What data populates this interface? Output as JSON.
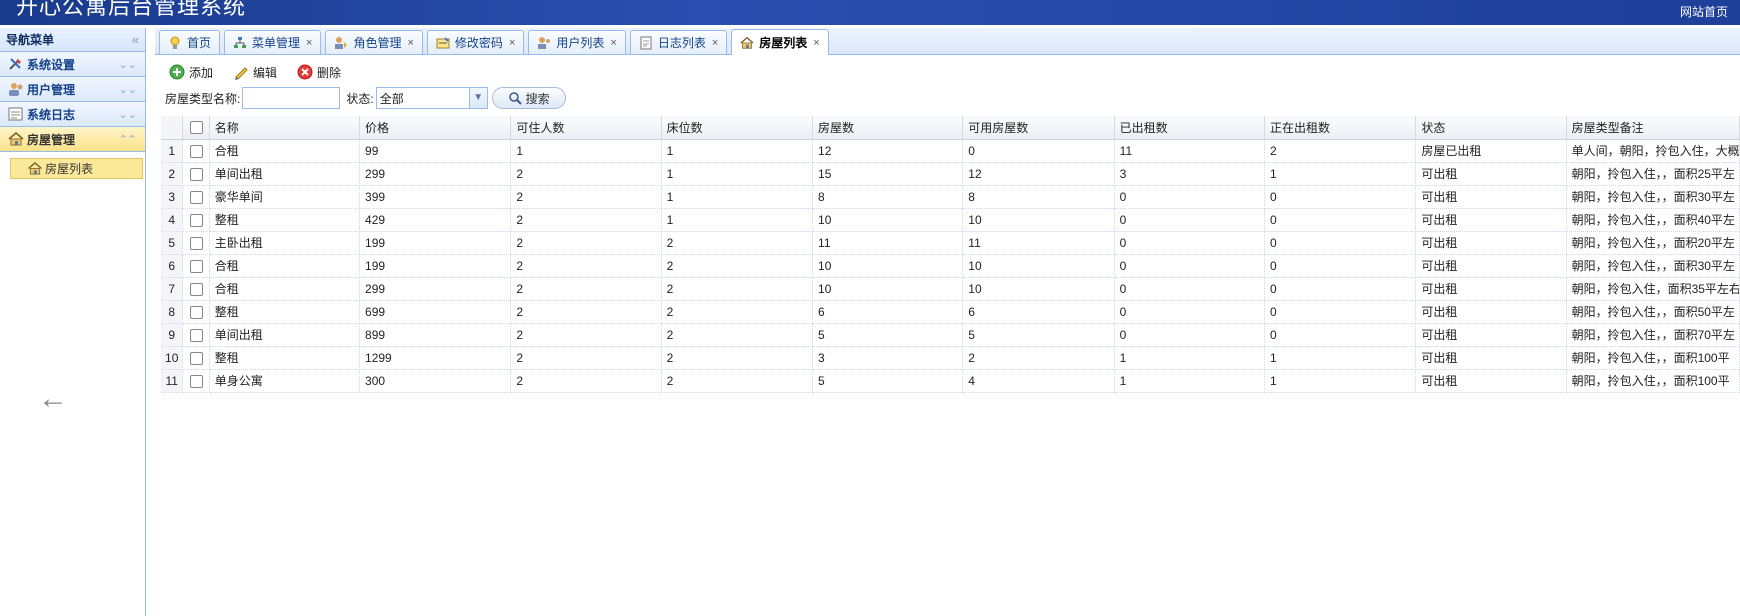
{
  "header": {
    "title": "开心公寓后台管理系统",
    "home_link": "网站首页"
  },
  "sidebar": {
    "title": "导航菜单",
    "collapse_icon": "double-chevron-left",
    "panels": [
      {
        "label": "系统设置",
        "icon": "tools-icon"
      },
      {
        "label": "用户管理",
        "icon": "users-icon"
      },
      {
        "label": "系统日志",
        "icon": "log-icon"
      },
      {
        "label": "房屋管理",
        "icon": "house-icon",
        "active": true
      }
    ],
    "sub_item": {
      "label": "房屋列表",
      "icon": "house-icon"
    }
  },
  "tabs": [
    {
      "label": "首页",
      "closable": false
    },
    {
      "label": "菜单管理",
      "closable": true
    },
    {
      "label": "角色管理",
      "closable": true
    },
    {
      "label": "修改密码",
      "closable": true
    },
    {
      "label": "用户列表",
      "closable": true
    },
    {
      "label": "日志列表",
      "closable": true
    },
    {
      "label": "房屋列表",
      "closable": true,
      "active": true
    }
  ],
  "tab_close": "×",
  "toolbar": {
    "add": "添加",
    "edit": "编辑",
    "delete": "删除"
  },
  "search": {
    "name_label": "房屋类型名称:",
    "name_value": "",
    "status_label": "状态:",
    "status_value": "全部",
    "search_button": "搜索"
  },
  "table": {
    "columns": [
      "名称",
      "价格",
      "可住人数",
      "床位数",
      "房屋数",
      "可用房屋数",
      "已出租数",
      "正在出租数",
      "状态",
      "房屋类型备注"
    ],
    "rows": [
      [
        "1",
        "合租",
        "99",
        "1",
        "1",
        "12",
        "0",
        "11",
        "2",
        "房屋已出租",
        "单人间，朝阳，拎包入住，大概"
      ],
      [
        "2",
        "单间出租",
        "299",
        "2",
        "1",
        "15",
        "12",
        "3",
        "1",
        "可出租",
        "朝阳，拎包入住，，面积25平左"
      ],
      [
        "3",
        "豪华单间",
        "399",
        "2",
        "1",
        "8",
        "8",
        "0",
        "0",
        "可出租",
        "朝阳，拎包入住，，面积30平左"
      ],
      [
        "4",
        "整租",
        "429",
        "2",
        "1",
        "10",
        "10",
        "0",
        "0",
        "可出租",
        "朝阳，拎包入住，，面积40平左"
      ],
      [
        "5",
        "主卧出租",
        "199",
        "2",
        "2",
        "11",
        "11",
        "0",
        "0",
        "可出租",
        "朝阳，拎包入住，，面积20平左"
      ],
      [
        "6",
        "合租",
        "199",
        "2",
        "2",
        "10",
        "10",
        "0",
        "0",
        "可出租",
        "朝阳，拎包入住，，面积30平左"
      ],
      [
        "7",
        "合租",
        "299",
        "2",
        "2",
        "10",
        "10",
        "0",
        "0",
        "可出租",
        "朝阳，拎包入住，面积35平左右"
      ],
      [
        "8",
        "整租",
        "699",
        "2",
        "2",
        "6",
        "6",
        "0",
        "0",
        "可出租",
        "朝阳，拎包入住，，面积50平左"
      ],
      [
        "9",
        "单间出租",
        "899",
        "2",
        "2",
        "5",
        "5",
        "0",
        "0",
        "可出租",
        "朝阳，拎包入住，，面积70平左"
      ],
      [
        "10",
        "整租",
        "1299",
        "2",
        "2",
        "3",
        "2",
        "1",
        "1",
        "可出租",
        "朝阳，拎包入住，，面积100平"
      ],
      [
        "11",
        "单身公寓",
        "300",
        "2",
        "2",
        "5",
        "4",
        "1",
        "1",
        "可出租",
        "朝阳，拎包入住，，面积100平"
      ]
    ]
  },
  "back_arrow": "←",
  "colors": {
    "header_bg": "#2a4fb0",
    "active_panel": "#fbe28a",
    "border": "#99bbe8"
  }
}
